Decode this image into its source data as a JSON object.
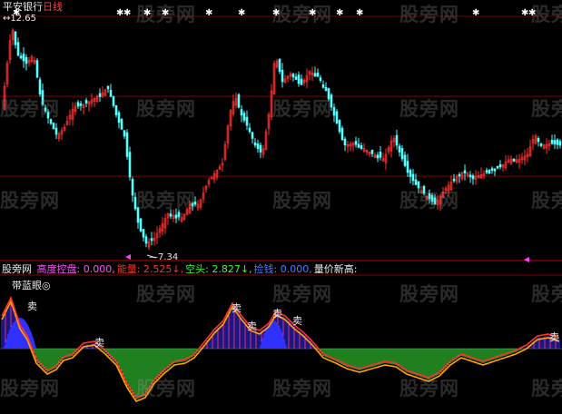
{
  "header": {
    "symbol": "平安银行",
    "period": "日线",
    "high_label": "12.65",
    "low_label": "7.34"
  },
  "indicator_bar": {
    "source": "股旁网",
    "items": [
      {
        "label": "高度控盘:",
        "value": "0.000,",
        "color": "#ff50ff"
      },
      {
        "label": "能量:",
        "value": "2.525↓,",
        "color": "#ff3030"
      },
      {
        "label": "空头:",
        "value": "2.827↓,",
        "color": "#30ff30"
      },
      {
        "label": "捡钱:",
        "value": "0.000,",
        "color": "#4d7dff"
      },
      {
        "label": "量价新高:",
        "value": "",
        "color": "#f0f0f0"
      }
    ]
  },
  "indicator_title": "带蓝眼◎",
  "signal_text": "卖",
  "star_glyph": "✱",
  "watermark_text": "股旁网",
  "colors": {
    "background": "#000000",
    "up_candle": "#ff3030",
    "down_candle": "#54ffff",
    "grid_line": "#8b0000",
    "price_red": "#ff3030",
    "price_orange": "#ffa500",
    "bar_blue": "#3030ff",
    "bar_magenta": "#ff40ff",
    "bar_green": "#40ff40"
  }
}
